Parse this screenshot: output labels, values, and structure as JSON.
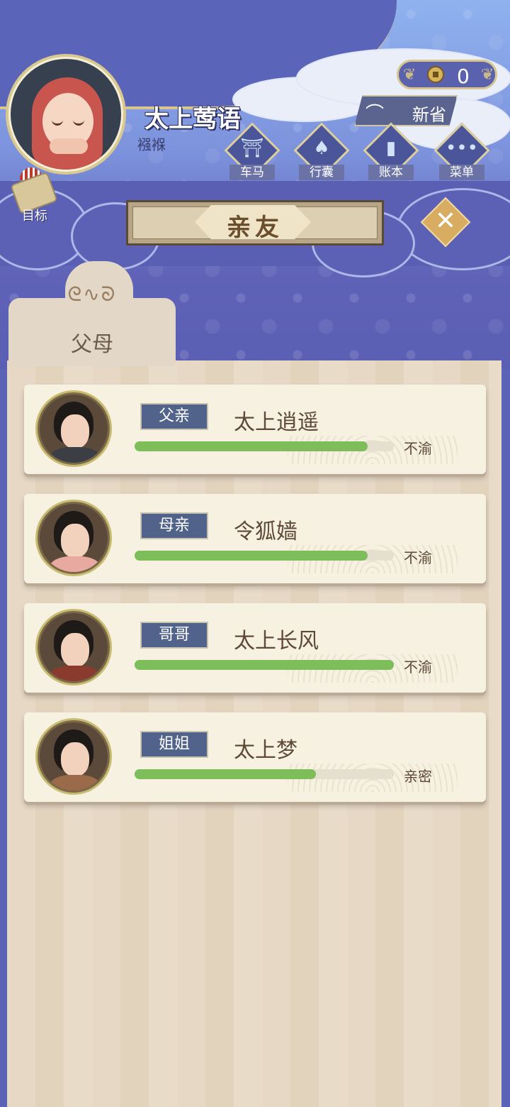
{
  "player": {
    "name": "太上莺语",
    "stage": "襁褓"
  },
  "coins": {
    "count": "0"
  },
  "renew": {
    "label": "新省"
  },
  "menu": [
    {
      "label": "车马",
      "icon": "carriage-icon"
    },
    {
      "label": "行囊",
      "icon": "bundle-icon"
    },
    {
      "label": "账本",
      "icon": "book-icon"
    },
    {
      "label": "菜单",
      "icon": "more-icon"
    }
  ],
  "goal": {
    "label": "目标"
  },
  "title": "亲友",
  "tab": {
    "label": "父母"
  },
  "relatives": [
    {
      "role": "父亲",
      "name": "太上逍遥",
      "status": "不渝",
      "affinity": 0.9,
      "look": "father"
    },
    {
      "role": "母亲",
      "name": "令狐嫱",
      "status": "不渝",
      "affinity": 0.9,
      "look": "mother"
    },
    {
      "role": "哥哥",
      "name": "太上长风",
      "status": "不渝",
      "affinity": 1.0,
      "look": "brother"
    },
    {
      "role": "姐姐",
      "name": "太上梦",
      "status": "亲密",
      "affinity": 0.7,
      "look": "sister"
    }
  ],
  "colors": {
    "bar": "#7dbe5a",
    "badge": "#51638a",
    "background": "#5b5fb3"
  }
}
